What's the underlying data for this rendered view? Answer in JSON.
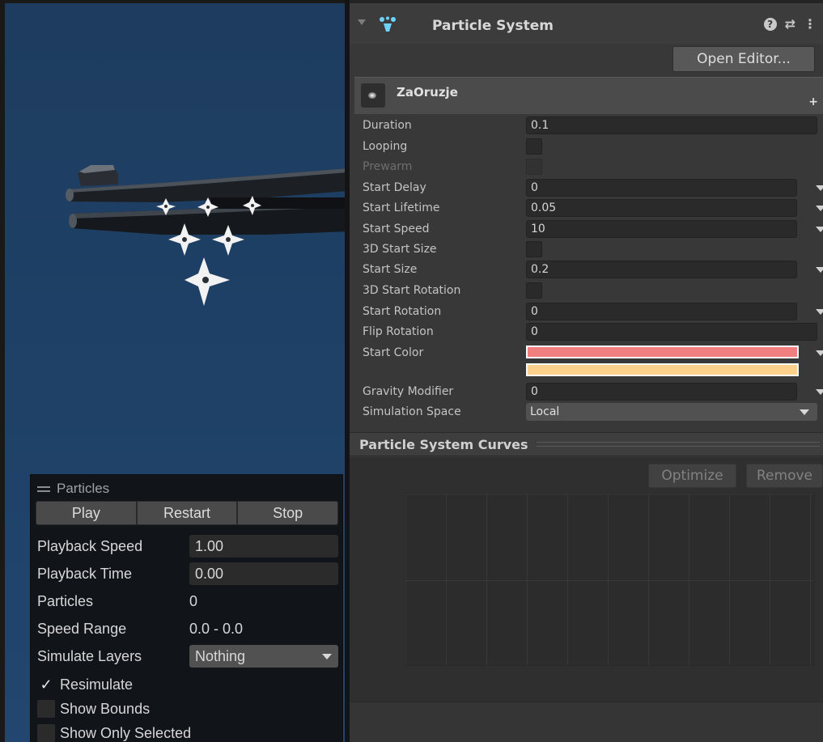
{
  "overlay": {
    "title": "Particles",
    "buttons": {
      "play": "Play",
      "restart": "Restart",
      "stop": "Stop"
    },
    "playback_speed": {
      "label": "Playback Speed",
      "value": "1.00"
    },
    "playback_time": {
      "label": "Playback Time",
      "value": "0.00"
    },
    "particles": {
      "label": "Particles",
      "value": "0"
    },
    "speed_range": {
      "label": "Speed Range",
      "value": "0.0 - 0.0"
    },
    "simulate_layers": {
      "label": "Simulate Layers",
      "value": "Nothing"
    },
    "resimulate": {
      "label": "Resimulate",
      "checked": true
    },
    "show_bounds": {
      "label": "Show Bounds",
      "checked": false
    },
    "show_only_selected": {
      "label": "Show Only Selected",
      "checked": false
    }
  },
  "inspector": {
    "component_title": "Particle System",
    "open_editor": "Open Editor...",
    "system_name": "ZaOruzje",
    "properties": {
      "duration": {
        "label": "Duration",
        "value": "0.1"
      },
      "looping": {
        "label": "Looping",
        "checked": false
      },
      "prewarm": {
        "label": "Prewarm",
        "checked": false
      },
      "start_delay": {
        "label": "Start Delay",
        "value": "0"
      },
      "start_lifetime": {
        "label": "Start Lifetime",
        "value": "0.05"
      },
      "start_speed": {
        "label": "Start Speed",
        "value": "10"
      },
      "start_size_3d": {
        "label": "3D Start Size",
        "checked": false
      },
      "start_size": {
        "label": "Start Size",
        "value": "0.2"
      },
      "start_rotation_3d": {
        "label": "3D Start Rotation",
        "checked": false
      },
      "start_rotation": {
        "label": "Start Rotation",
        "value": "0"
      },
      "flip_rotation": {
        "label": "Flip Rotation",
        "value": "0"
      },
      "start_color": {
        "label": "Start Color",
        "color_a": "#f27f80",
        "color_b": "#fdd08c"
      },
      "gravity_modifier": {
        "label": "Gravity Modifier",
        "value": "0"
      },
      "simulation_space": {
        "label": "Simulation Space",
        "value": "Local"
      }
    },
    "curves": {
      "title": "Particle System Curves",
      "optimize": "Optimize",
      "remove": "Remove"
    }
  },
  "colors": {
    "scene_bg": "#1f4168",
    "panel_bg": "#383838",
    "overlay_bg": "#11151a",
    "ps_icon": "#6fd3ff"
  }
}
